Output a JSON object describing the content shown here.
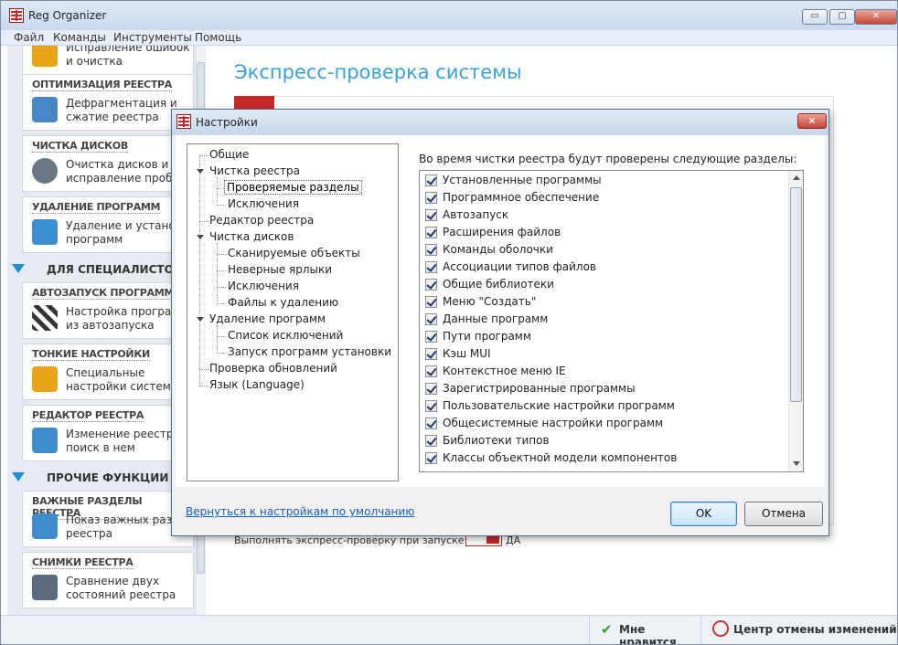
{
  "app": {
    "title": "Reg Organizer",
    "window_buttons": {
      "minimize": "▭",
      "maximize": "▢",
      "close": "✕"
    }
  },
  "menu": [
    "Файл",
    "Команды",
    "Инструменты",
    "Помощь"
  ],
  "sidebar": {
    "top_partial": {
      "desc": "Исправление ошибок\nи очистка"
    },
    "items": [
      {
        "head": "ОПТИМИЗАЦИЯ РЕЕСТРА",
        "desc": "Дефрагментация и\nсжатие реестра",
        "icon": "registry-defrag-icon",
        "color": "#4a86c5"
      },
      {
        "head": "ЧИСТКА ДИСКОВ",
        "desc": "Очистка дисков и\nисправление пробле",
        "icon": "disk-clean-icon",
        "color": "#6b7785"
      },
      {
        "head": "УДАЛЕНИЕ ПРОГРАММ",
        "desc": "Удаление и установк\nпрограмм",
        "icon": "uninstall-icon",
        "color": "#3a8fd0"
      },
      {
        "head": "АВТОЗАПУСК ПРОГРАММ",
        "desc": "Настройка программ\nиз автозапуска",
        "icon": "autostart-flag-icon",
        "color": "#444"
      },
      {
        "head": "ТОНКИЕ НАСТРОЙКИ",
        "desc": "Специальные\nнастройки системы",
        "icon": "windows-tweak-icon",
        "color": "#e8a317"
      },
      {
        "head": "РЕДАКТОР РЕЕСТРА",
        "desc": "Изменение реестра и\nпоиск в нем",
        "icon": "registry-editor-icon",
        "color": "#3f8ccc"
      },
      {
        "head": "ВАЖНЫЕ РАЗДЕЛЫ РЕЕСТРА",
        "desc": "Показ важных раздел\nреестра",
        "icon": "important-keys-icon",
        "color": "#3f8ccc"
      },
      {
        "head": "СНИМКИ РЕЕСТРА",
        "desc": "Сравнение двух\nсостояний реестра",
        "icon": "registry-snapshot-icon",
        "color": "#5a6b7d"
      }
    ],
    "sections": [
      "ДЛЯ СПЕЦИАЛИСТОВ",
      "ПРОЧИЕ ФУНКЦИИ"
    ]
  },
  "main": {
    "title": "Экспресс-проверка системы",
    "quick_check_label": "Выполнять экспресс-проверку при запуске:",
    "quick_check_value": "ДА"
  },
  "statusbar": {
    "like": "Мне нравится",
    "undo_center": "Центр отмены изменений"
  },
  "dialog": {
    "title": "Настройки",
    "close": "✕",
    "tree": [
      {
        "label": "Общие",
        "level": 0
      },
      {
        "label": "Чистка реестра",
        "level": 0,
        "expanded": true
      },
      {
        "label": "Проверяемые разделы",
        "level": 1,
        "selected": true
      },
      {
        "label": "Исключения",
        "level": 1
      },
      {
        "label": "Редактор реестра",
        "level": 0
      },
      {
        "label": "Чистка дисков",
        "level": 0,
        "expanded": true
      },
      {
        "label": "Сканируемые объекты",
        "level": 1
      },
      {
        "label": "Неверные ярлыки",
        "level": 1
      },
      {
        "label": "Исключения",
        "level": 1
      },
      {
        "label": "Файлы к удалению",
        "level": 1
      },
      {
        "label": "Удаление программ",
        "level": 0,
        "expanded": true
      },
      {
        "label": "Список исключений",
        "level": 1
      },
      {
        "label": "Запуск программ установки",
        "level": 1
      },
      {
        "label": "Проверка обновлений",
        "level": 0
      },
      {
        "label": "Язык (Language)",
        "level": 0
      }
    ],
    "list_label": "Во время чистки реестра будут проверены следующие разделы:",
    "list_items": [
      {
        "label": "Установленные программы",
        "checked": true
      },
      {
        "label": "Программное обеспечение",
        "checked": true
      },
      {
        "label": "Автозапуск",
        "checked": true
      },
      {
        "label": "Расширения файлов",
        "checked": true
      },
      {
        "label": "Команды оболочки",
        "checked": true
      },
      {
        "label": "Ассоциации типов файлов",
        "checked": true
      },
      {
        "label": "Общие библиотеки",
        "checked": true
      },
      {
        "label": "Меню \"Создать\"",
        "checked": true
      },
      {
        "label": "Данные программ",
        "checked": true
      },
      {
        "label": "Пути программ",
        "checked": true
      },
      {
        "label": "Кэш MUI",
        "checked": true
      },
      {
        "label": "Контекстное меню IE",
        "checked": true
      },
      {
        "label": "Зарегистрированные программы",
        "checked": true
      },
      {
        "label": "Пользовательские настройки программ",
        "checked": true
      },
      {
        "label": "Общесистемные настройки программ",
        "checked": true
      },
      {
        "label": "Библиотеки типов",
        "checked": true
      },
      {
        "label": "Классы объектной модели компонентов",
        "checked": true
      }
    ],
    "reset_link": "Вернуться к настройкам по умолчанию",
    "ok": "OK",
    "cancel": "Отмена"
  }
}
